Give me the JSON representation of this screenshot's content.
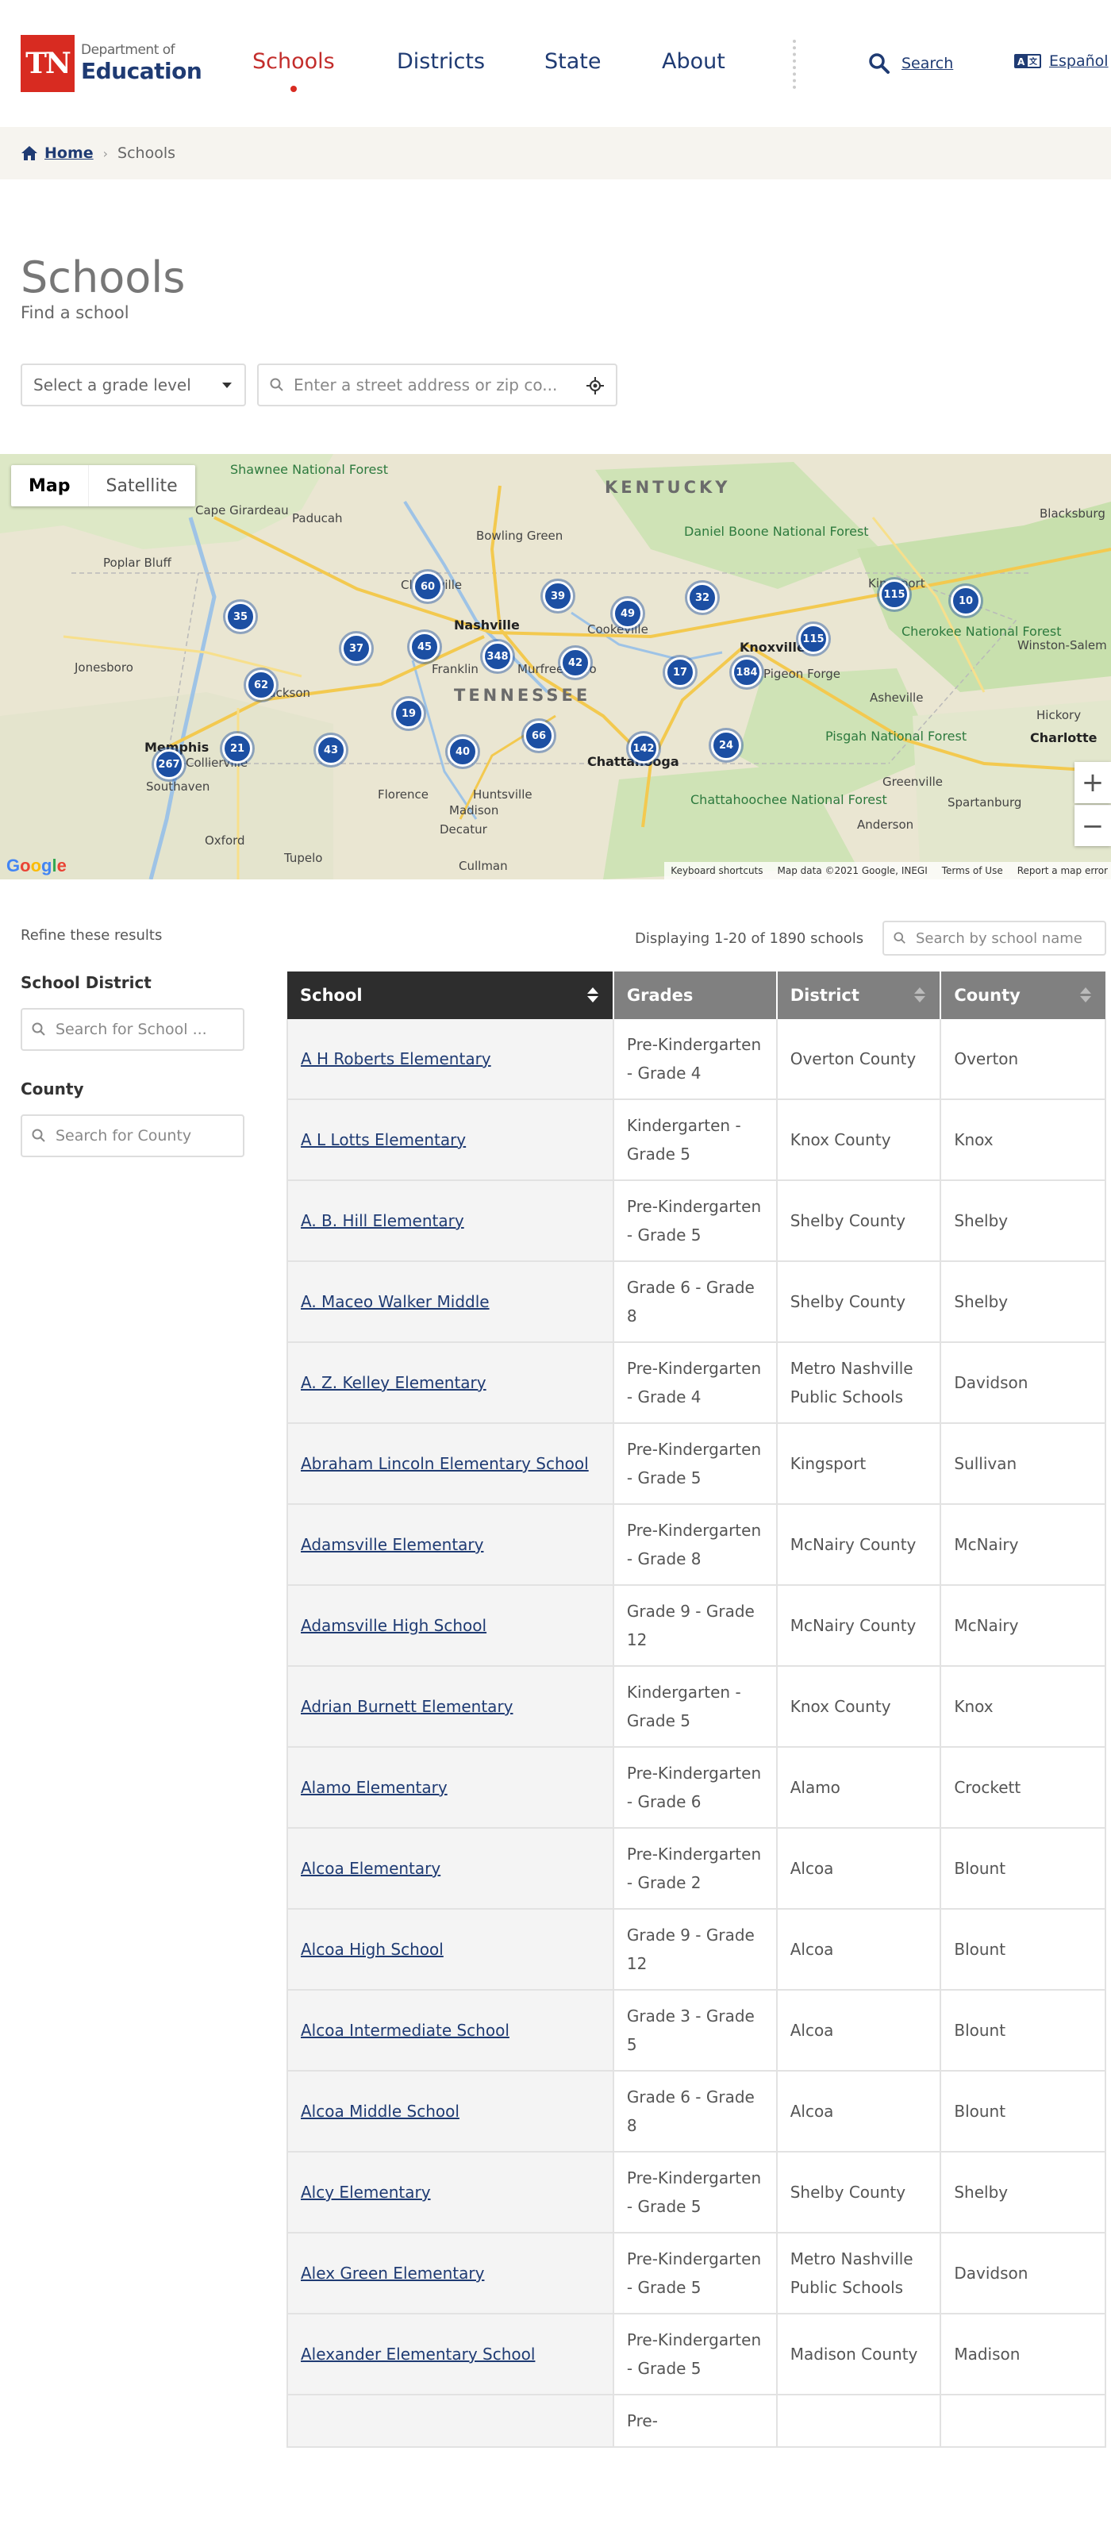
{
  "header": {
    "logo": {
      "mark": "TN",
      "line1": "Department of",
      "line2": "Education"
    },
    "nav": [
      {
        "label": "Schools",
        "active": true
      },
      {
        "label": "Districts"
      },
      {
        "label": "State"
      },
      {
        "label": "About"
      }
    ],
    "search_label": "Search",
    "language_label": "Español"
  },
  "breadcrumb": {
    "home": "Home",
    "current": "Schools"
  },
  "page": {
    "title": "Schools",
    "subtitle": "Find a school"
  },
  "filters": {
    "grade_placeholder": "Select a grade level",
    "address_placeholder": "Enter a street address or zip co..."
  },
  "map": {
    "tabs": [
      "Map",
      "Satellite"
    ],
    "zoom_in": "+",
    "zoom_out": "−",
    "state_labels": [
      "KENTUCKY",
      "TENNESSEE"
    ],
    "parks": [
      "Shawnee National Forest",
      "Daniel Boone National Forest",
      "Cherokee National Forest",
      "Pisgah National Forest",
      "Chattahoochee National Forest"
    ],
    "cities": [
      "Nashville",
      "Knoxville",
      "Memphis",
      "Chattanooga",
      "Charlotte",
      "Huntsville",
      "Jackson",
      "Clarksville",
      "Bowling Green",
      "Murfreesboro",
      "Franklin",
      "Cookeville",
      "Asheville",
      "Kingsport",
      "Winston-Salem",
      "Greenville",
      "Spartanburg",
      "Jonesboro",
      "Paducah",
      "Cape Girardeau",
      "Poplar Bluff",
      "Tupelo",
      "Oxford",
      "Florence",
      "Decatur",
      "Cullman",
      "Anderson",
      "Blacksburg",
      "Hickory",
      "Southaven",
      "Collierville",
      "Pigeon Forge",
      "Madison"
    ],
    "clusters": [
      "60",
      "39",
      "49",
      "32",
      "115",
      "10",
      "35",
      "37",
      "45",
      "348",
      "42",
      "17",
      "115",
      "184",
      "62",
      "19",
      "66",
      "142",
      "24",
      "21",
      "43",
      "40",
      "267"
    ],
    "footer": [
      "Keyboard shortcuts",
      "Map data ©2021 Google, INEGI",
      "Terms of Use",
      "Report a map error"
    ],
    "google": "Google"
  },
  "sidebar": {
    "refine_label": "Refine these results",
    "district_label": "School District",
    "district_placeholder": "Search for School ...",
    "county_label": "County",
    "county_placeholder": "Search for County"
  },
  "results": {
    "displaying": "Displaying 1-20 of 1890 schools",
    "search_placeholder": "Search by school name",
    "columns": [
      "School",
      "Grades",
      "District",
      "County"
    ],
    "rows": [
      {
        "school": "A H Roberts Elementary",
        "grades": "Pre-Kindergarten - Grade 4",
        "district": "Overton County",
        "county": "Overton"
      },
      {
        "school": "A L Lotts Elementary",
        "grades": "Kindergarten - Grade 5",
        "district": "Knox County",
        "county": "Knox"
      },
      {
        "school": "A. B. Hill Elementary",
        "grades": "Pre-Kindergarten - Grade 5",
        "district": "Shelby County",
        "county": "Shelby"
      },
      {
        "school": "A. Maceo Walker Middle",
        "grades": "Grade 6 - Grade 8",
        "district": "Shelby County",
        "county": "Shelby"
      },
      {
        "school": "A. Z. Kelley Elementary",
        "grades": "Pre-Kindergarten - Grade 4",
        "district": "Metro Nashville Public Schools",
        "county": "Davidson"
      },
      {
        "school": "Abraham Lincoln Elementary School",
        "grades": "Pre-Kindergarten - Grade 5",
        "district": "Kingsport",
        "county": "Sullivan"
      },
      {
        "school": "Adamsville Elementary",
        "grades": "Pre-Kindergarten - Grade 8",
        "district": "McNairy County",
        "county": "McNairy"
      },
      {
        "school": "Adamsville High School",
        "grades": "Grade 9 - Grade 12",
        "district": "McNairy County",
        "county": "McNairy"
      },
      {
        "school": "Adrian Burnett Elementary",
        "grades": "Kindergarten - Grade 5",
        "district": "Knox County",
        "county": "Knox"
      },
      {
        "school": "Alamo Elementary",
        "grades": "Pre-Kindergarten - Grade 6",
        "district": "Alamo",
        "county": "Crockett"
      },
      {
        "school": "Alcoa Elementary",
        "grades": "Pre-Kindergarten - Grade 2",
        "district": "Alcoa",
        "county": "Blount"
      },
      {
        "school": "Alcoa High School",
        "grades": "Grade 9 - Grade 12",
        "district": "Alcoa",
        "county": "Blount"
      },
      {
        "school": "Alcoa Intermediate School",
        "grades": "Grade 3 - Grade 5",
        "district": "Alcoa",
        "county": "Blount"
      },
      {
        "school": "Alcoa Middle School",
        "grades": "Grade 6 - Grade 8",
        "district": "Alcoa",
        "county": "Blount"
      },
      {
        "school": "Alcy Elementary",
        "grades": "Pre-Kindergarten - Grade 5",
        "district": "Shelby County",
        "county": "Shelby"
      },
      {
        "school": "Alex Green Elementary",
        "grades": "Pre-Kindergarten - Grade 5",
        "district": "Metro Nashville Public Schools",
        "county": "Davidson"
      },
      {
        "school": "Alexander Elementary School",
        "grades": "Pre-Kindergarten - Grade 5",
        "district": "Madison County",
        "county": "Madison"
      },
      {
        "school": "",
        "grades": "Pre-",
        "district": "",
        "county": ""
      }
    ]
  },
  "colors": {
    "brand_red": "#d82b21",
    "navy": "#1f3b73",
    "cluster_blue": "#1c4fa3"
  }
}
